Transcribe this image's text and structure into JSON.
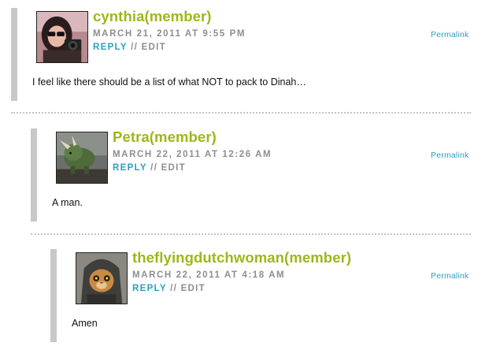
{
  "comments": [
    {
      "author": "cynthia(member)",
      "date": "MARCH 21, 2011 AT 9:55 PM",
      "reply": "REPLY",
      "separator": "//",
      "edit": "EDIT",
      "permalink": "Permalink",
      "text": "I feel like there should be a list of what NOT to pack to Dinah…",
      "avatar_icon": "person-with-camera-avatar"
    },
    {
      "author": "Petra(member)",
      "date": "MARCH 22, 2011 AT 12:26 AM",
      "reply": "REPLY",
      "separator": "//",
      "edit": "EDIT",
      "permalink": "Permalink",
      "text": "A man.",
      "avatar_icon": "triceratops-avatar"
    },
    {
      "author": "theflyingdutchwoman(member)",
      "date": "MARCH 22, 2011 AT 4:18 AM",
      "reply": "REPLY",
      "separator": "//",
      "edit": "EDIT",
      "permalink": "Permalink",
      "text": "Amen",
      "avatar_icon": "cat-in-hoodie-avatar"
    }
  ],
  "colors": {
    "author": "#a0b61a",
    "link": "#2aa0c0",
    "meta": "#8e8e8e",
    "thread_bar": "#c8c8c8"
  }
}
